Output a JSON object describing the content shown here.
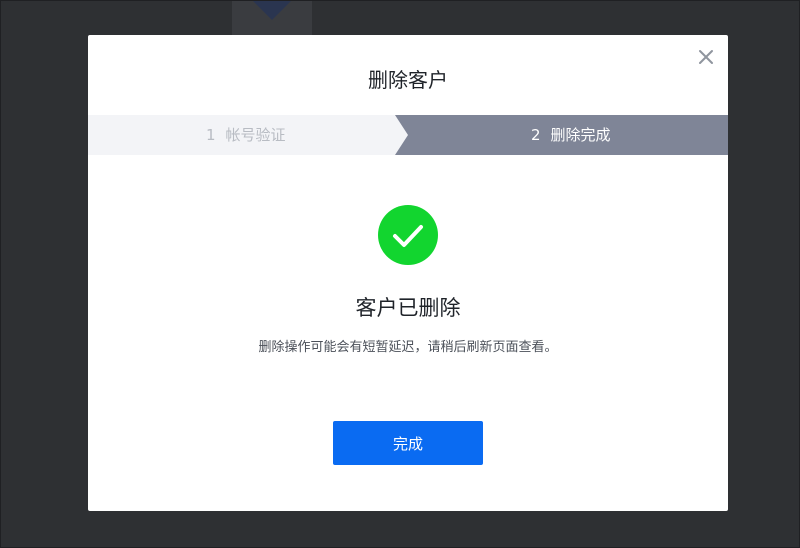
{
  "dialog": {
    "title": "删除客户",
    "close_icon": "close-icon"
  },
  "steps": [
    {
      "number": "1",
      "label": "帐号验证",
      "state": "inactive"
    },
    {
      "number": "2",
      "label": "删除完成",
      "state": "active"
    }
  ],
  "result": {
    "icon": "check-circle-icon",
    "title": "客户已删除",
    "description": "删除操作可能会有短暂延迟，请稍后刷新页面查看。"
  },
  "actions": {
    "done_label": "完成"
  },
  "colors": {
    "overlay": "#2e3033",
    "active_step": "#7f8597",
    "inactive_step_bg": "#f3f4f7",
    "success": "#12d52f",
    "primary_button": "#0a6bf2"
  }
}
